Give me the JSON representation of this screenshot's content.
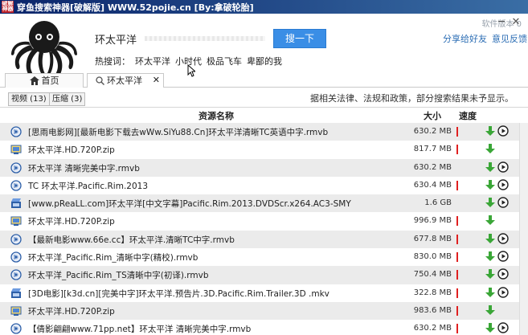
{
  "window": {
    "title": "穿鱼搜索神器[破解版] WWW.52pojie.cn [By:拿破轮胎]",
    "app_icon_text": "破解 神器"
  },
  "header": {
    "version_label": "软件版本 0",
    "search_value": "环太平洋",
    "search_button": "搜一下",
    "share_link": "分享给好友",
    "feedback_link": "意见反馈",
    "min_glyph": "─",
    "close_glyph": "✕",
    "hot_label": "热搜词：",
    "hot_keywords": [
      "环太平洋",
      "小时代",
      "极品飞车",
      "卑鄙的我"
    ]
  },
  "tabs": [
    {
      "label": "首页",
      "icon": "home-icon"
    },
    {
      "label": "环太平洋",
      "icon": "search-icon",
      "close": "✕"
    }
  ],
  "filters": {
    "video": "视频 (13)",
    "zip": "压缩 (3)"
  },
  "notice": "据相关法律、法规和政策，部分搜索结果未予显示。",
  "table": {
    "headers": {
      "name": "资源名称",
      "size": "大小",
      "speed": "速度"
    },
    "rows": [
      {
        "icon": "video-file-icon",
        "name": "[思雨电影网][最新电影下载去wWw.SiYu88.Cn]环太平洋清晰TC英语中字.rmvb",
        "size": "630.2 MB",
        "speed": true,
        "play": true
      },
      {
        "icon": "zip-file-icon",
        "name": "环太平洋.HD.720P.zip",
        "size": "817.7 MB",
        "speed": true,
        "play": false
      },
      {
        "icon": "video-file-icon",
        "name": "环太平洋 清晰完美中字.rmvb",
        "size": "630.2 MB",
        "speed": false,
        "play": true
      },
      {
        "icon": "video-file-icon",
        "name": "TC 环太平洋.Pacific.Rim.2013",
        "size": "630.4 MB",
        "speed": true,
        "play": true
      },
      {
        "icon": "movie-file-icon",
        "name": "[www.pReaLL.com]环太平洋[中文字幕]Pacific.Rim.2013.DVDScr.x264.AC3-SMY",
        "size": "1.6 GB",
        "speed": false,
        "play": true
      },
      {
        "icon": "zip-file-icon",
        "name": "环太平洋.HD.720P.zip",
        "size": "996.9 MB",
        "speed": true,
        "play": false
      },
      {
        "icon": "video-file-icon",
        "name": "【最新电影www.66e.cc】环太平洋.清晰TC中字.rmvb",
        "size": "677.8 MB",
        "speed": true,
        "play": true
      },
      {
        "icon": "video-file-icon",
        "name": "环太平洋_Pacific.Rim_清晰中字(精校).rmvb",
        "size": "830.0 MB",
        "speed": true,
        "play": true
      },
      {
        "icon": "video-file-icon",
        "name": "环太平洋_Pacific.Rim_TS清晰中字(初译).rmvb",
        "size": "750.4 MB",
        "speed": true,
        "play": true
      },
      {
        "icon": "movie-file-icon",
        "name": "[3D电影][k3d.cn][完美中字]环太平洋.预告片.3D.Pacific.Rim.Trailer.3D .mkv",
        "size": "322.8 MB",
        "speed": true,
        "play": true
      },
      {
        "icon": "zip-file-icon",
        "name": "环太平洋.HD.720P.zip",
        "size": "983.6 MB",
        "speed": true,
        "play": false
      },
      {
        "icon": "video-file-icon",
        "name": "【倩影翩翩www.71pp.net】环太平洋 清晰完美中字.rmvb",
        "size": "630.2 MB",
        "speed": true,
        "play": true
      }
    ]
  },
  "colors": {
    "accent": "#3a8ee6",
    "link": "#2b6db4",
    "speed": "#e02020",
    "download": "#3aa637"
  }
}
